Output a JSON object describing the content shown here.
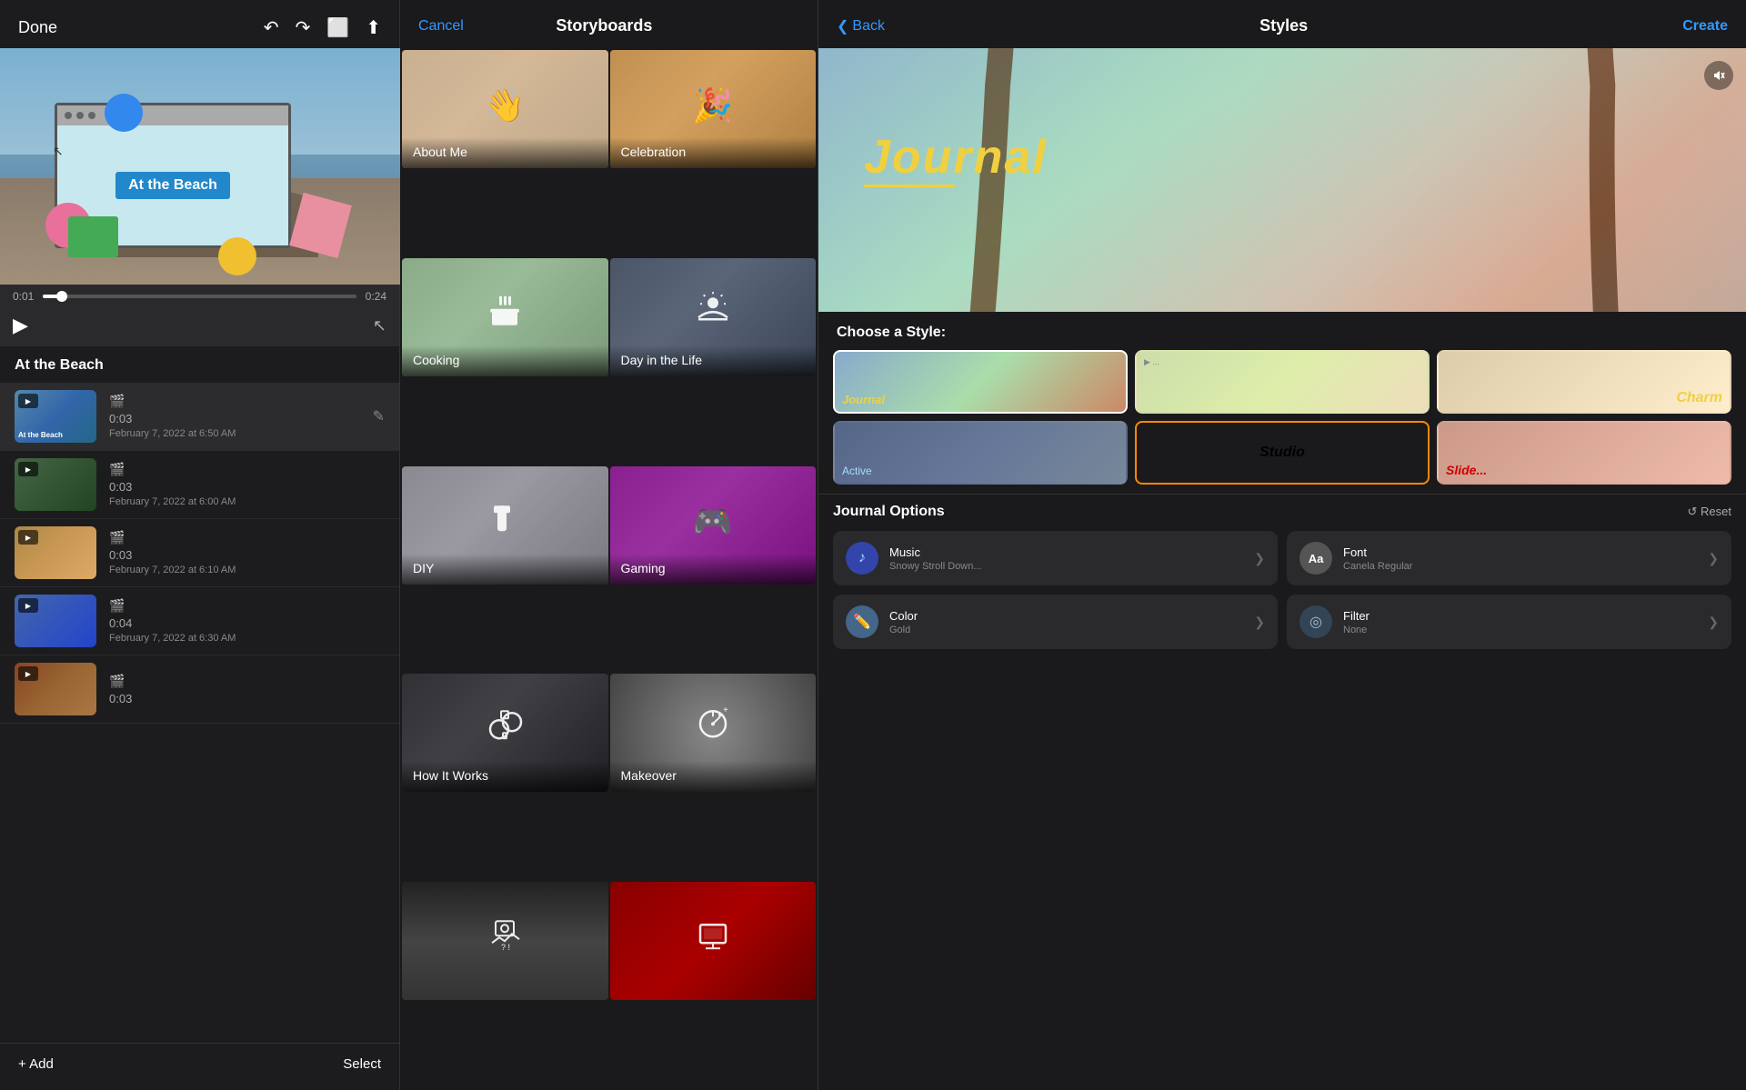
{
  "editor": {
    "done_label": "Done",
    "project_title": "At the Beach",
    "add_label": "+ Add",
    "select_label": "Select",
    "time_current": "0:01",
    "time_total": "0:24",
    "clips": [
      {
        "id": 1,
        "duration": "0:03",
        "date": "February 7, 2022 at 6:50 AM",
        "thumb_class": "clip-thumb-1",
        "label": "At the Beach"
      },
      {
        "id": 2,
        "duration": "0:03",
        "date": "February 7, 2022 at 6:00 AM",
        "thumb_class": "clip-thumb-2",
        "label": ""
      },
      {
        "id": 3,
        "duration": "0:03",
        "date": "February 7, 2022 at 6:10 AM",
        "thumb_class": "clip-thumb-3",
        "label": ""
      },
      {
        "id": 4,
        "duration": "0:04",
        "date": "February 7, 2022 at 6:30 AM",
        "thumb_class": "clip-thumb-4",
        "label": ""
      },
      {
        "id": 5,
        "duration": "0:03",
        "date": "",
        "thumb_class": "clip-thumb-5",
        "label": ""
      }
    ]
  },
  "storyboards": {
    "cancel_label": "Cancel",
    "title": "Storyboards",
    "cards": [
      {
        "id": "about-me",
        "label": "About Me",
        "bg_class": "story-card-bg-aboutme",
        "icon": "👋"
      },
      {
        "id": "celebration",
        "label": "Celebration",
        "bg_class": "story-card-bg-celebration",
        "icon": "🎉"
      },
      {
        "id": "cooking",
        "label": "Cooking",
        "bg_class": "story-card-bg-cooking",
        "icon": "🍳"
      },
      {
        "id": "day-in-life",
        "label": "Day in the Life",
        "bg_class": "story-card-bg-dayinlife",
        "icon": "🌅"
      },
      {
        "id": "diy",
        "label": "DIY",
        "bg_class": "story-card-bg-diy",
        "icon": "🎨"
      },
      {
        "id": "gaming",
        "label": "Gaming",
        "bg_class": "story-card-bg-gaming",
        "icon": "🎮"
      },
      {
        "id": "how-it-works",
        "label": "How It Works",
        "bg_class": "story-card-bg-howitworks",
        "icon": "⚙️"
      },
      {
        "id": "makeover",
        "label": "Makeover",
        "bg_class": "story-card-bg-makeover",
        "icon": "🔍"
      },
      {
        "id": "music-bottom1",
        "label": "",
        "bg_class": "story-card-bg-bottom1",
        "icon": "🎤"
      },
      {
        "id": "theater-bottom2",
        "label": "",
        "bg_class": "story-card-bg-bottom2",
        "icon": "🖥️"
      }
    ]
  },
  "styles": {
    "back_label": "Back",
    "title": "Styles",
    "create_label": "Create",
    "journal_title": "Journal",
    "choose_style_label": "Choose a Style:",
    "style_items": [
      {
        "id": "journal",
        "label": "Journal",
        "selected": true
      },
      {
        "id": "style2",
        "label": ""
      },
      {
        "id": "charm",
        "label": "Charm"
      },
      {
        "id": "active",
        "label": "Active"
      },
      {
        "id": "studio",
        "label": "Studio",
        "selected_orange": true
      },
      {
        "id": "slide",
        "label": "Slide..."
      }
    ],
    "options_title": "Journal Options",
    "reset_label": "↺ Reset",
    "options": [
      {
        "id": "music",
        "label": "Music",
        "value": "Snowy Stroll Down...",
        "icon": "♪",
        "icon_class": "option-icon-music"
      },
      {
        "id": "font",
        "label": "Font",
        "value": "Canela Regular",
        "icon": "Aa",
        "icon_class": "option-icon-font"
      },
      {
        "id": "color",
        "label": "Color",
        "value": "Gold",
        "icon": "✏️",
        "icon_class": "option-icon-color"
      },
      {
        "id": "filter",
        "label": "Filter",
        "value": "None",
        "icon": "◎",
        "icon_class": "option-icon-filter"
      }
    ]
  }
}
